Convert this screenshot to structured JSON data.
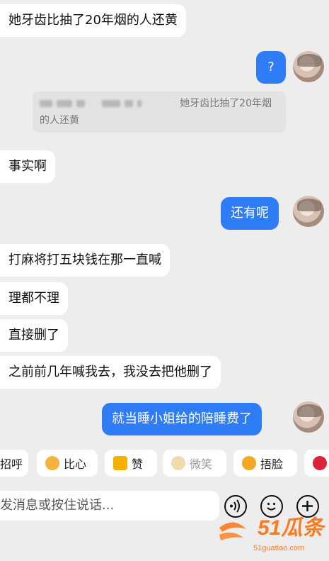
{
  "messages": [
    {
      "side": "left",
      "text": "她牙齿比抽了20年烟的人还黄"
    },
    {
      "side": "right",
      "text": "?"
    },
    {
      "side": "left",
      "text": "事实啊"
    },
    {
      "side": "right",
      "text": "还有呢"
    },
    {
      "side": "left",
      "text": "打麻将打五块钱在那一直喊"
    },
    {
      "side": "left",
      "text": "理都不理"
    },
    {
      "side": "left",
      "text": "直接删了"
    },
    {
      "side": "left",
      "text": "之前前几年喊我去，我没去把他删了"
    },
    {
      "side": "right",
      "text": "就当睡小姐给的陪睡费了"
    }
  ],
  "quote": {
    "text_line1": "她牙齿比抽了20年烟",
    "text_line2": "的人还黄"
  },
  "quick_replies": [
    {
      "label": "招呼",
      "icon": "wave-icon"
    },
    {
      "label": "比心",
      "icon": "heart-hands-emoji-icon"
    },
    {
      "label": "赞",
      "icon": "thumbs-up-icon"
    },
    {
      "label": "微笑",
      "icon": "smile-emoji-icon"
    },
    {
      "label": "捂脸",
      "icon": "facepalm-emoji-icon"
    },
    {
      "label": "",
      "icon": "rose-icon"
    }
  ],
  "input": {
    "placeholder": "发消息或按住说话..."
  },
  "watermark": {
    "brand": "51瓜条",
    "url": "51guatiao.com"
  },
  "colors": {
    "background": "#ededed",
    "bubble_right": "#2f7df6",
    "bubble_left": "#ffffff",
    "watermark": "#ff7a1a"
  }
}
